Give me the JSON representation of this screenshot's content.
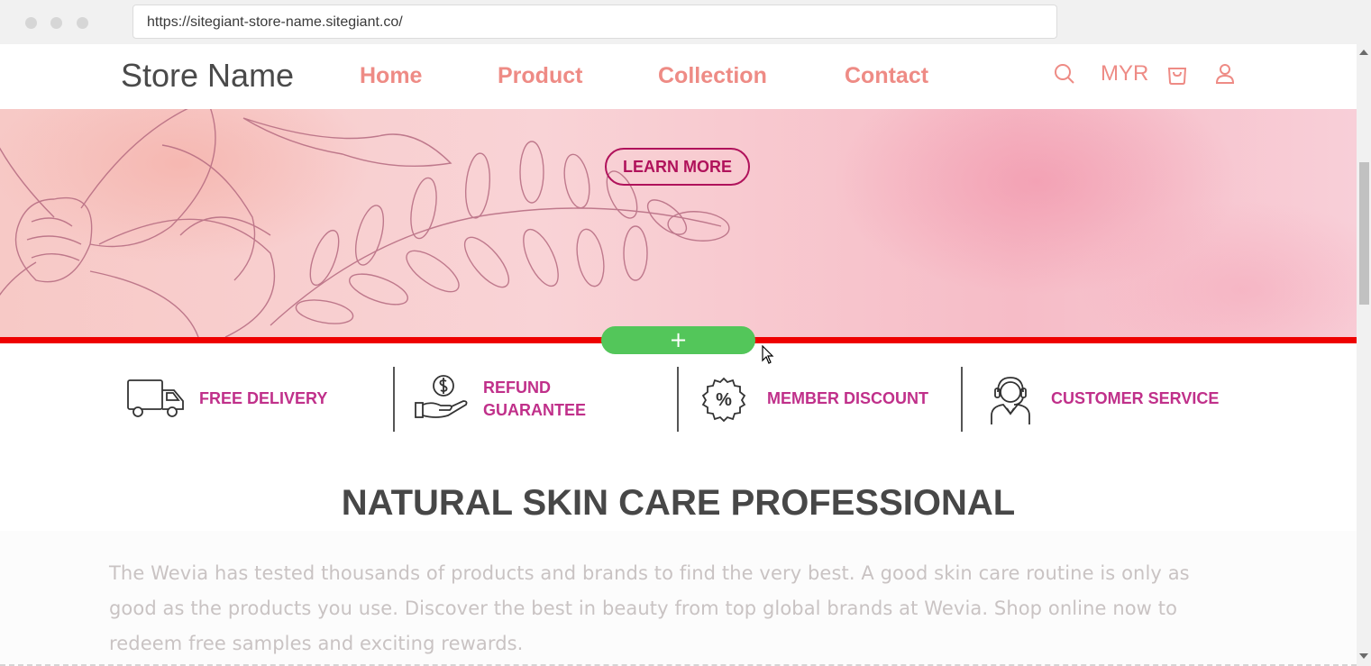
{
  "browser": {
    "url": "https://sitegiant-store-name.sitegiant.co/"
  },
  "header": {
    "logo": "Store Name",
    "nav": [
      "Home",
      "Product",
      "Collection",
      "Contact"
    ],
    "currency": "MYR",
    "icons": [
      "search-icon",
      "cart-icon",
      "user-icon"
    ]
  },
  "banner": {
    "cta_label": "LEARN MORE",
    "add_section_label": "+"
  },
  "features": [
    {
      "label": "FREE DELIVERY",
      "icon": "truck-icon"
    },
    {
      "label": "REFUND\nGUARANTEE",
      "icon": "refund-icon"
    },
    {
      "label": "MEMBER DISCOUNT",
      "icon": "discount-icon"
    },
    {
      "label": "CUSTOMER SERVICE",
      "icon": "headset-icon"
    }
  ],
  "intro": {
    "title": "NATURAL SKIN CARE PROFESSIONAL",
    "text": "The Wevia has tested thousands of products and brands to find the very best. A good skin care routine is only as good as the products you use. Discover the best in beauty from top global brands at Wevia. Shop online now to redeem free samples and exciting rewards."
  },
  "colors": {
    "nav": "#ee8b85",
    "accent": "#c0308a",
    "cta": "#b0125b",
    "divider_red": "#ee0000",
    "add_button": "#53c65a"
  }
}
